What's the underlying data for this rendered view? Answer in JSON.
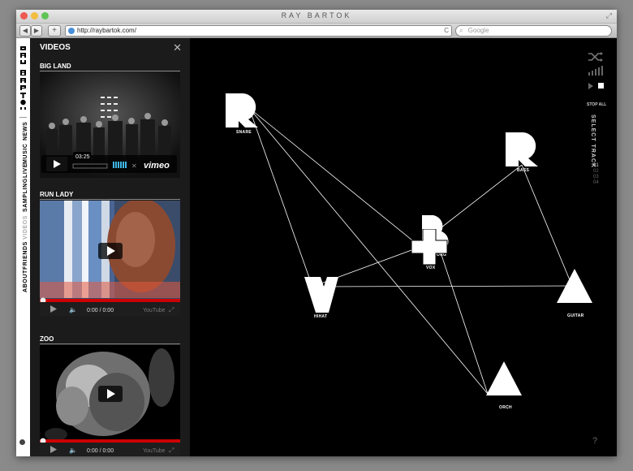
{
  "browser": {
    "window_title": "RAY BARTOK",
    "url": "http://raybartok.com/",
    "search_placeholder": "Google",
    "back_label": "◀",
    "forward_label": "▶",
    "add_label": "+",
    "reload_label": "C"
  },
  "nav": {
    "items": [
      "NEWS",
      "MUSIC",
      "LIVE",
      "SAMPLING",
      "VIDEOS",
      "FRIENDS",
      "ABOUT"
    ],
    "active": "VIDEOS",
    "logo_text": "RAY BARTOK"
  },
  "videos_panel": {
    "title": "VIDEOS",
    "videos": [
      {
        "title": "BIG LAND",
        "player": "vimeo",
        "time": "03:25",
        "brand": "vimeo"
      },
      {
        "title": "RUN LADY",
        "player": "youtube",
        "time": "0:00 / 0:00",
        "brand": "YouTube"
      },
      {
        "title": "ZOO",
        "player": "youtube",
        "time": "0:00 / 0:00",
        "brand": "YouTube"
      }
    ]
  },
  "stage": {
    "shapes": [
      {
        "label": "SNARE",
        "icon": "r-letter-icon"
      },
      {
        "label": "BASS",
        "icon": "r-letter-icon"
      },
      {
        "label": "VOX",
        "icon": "cross-icon"
      },
      {
        "label": "KORG",
        "icon": "b-letter-icon"
      },
      {
        "label": "HIHAT",
        "icon": "y-letter-icon"
      },
      {
        "label": "GUITAR",
        "icon": "triangle-icon"
      },
      {
        "label": "ORCH",
        "icon": "triangle-icon"
      }
    ],
    "controls": {
      "shuffle_icon": "shuffle-icon",
      "volume_icon": "volume-bars-icon",
      "stop_all": "STOP ALL"
    },
    "select_track": "SELECT TRACK",
    "tracks": [
      "01",
      "02",
      "03",
      "04"
    ],
    "active_track": "01",
    "help": "?"
  },
  "colors": {
    "stage_bg": "#000000",
    "panel_bg": "#1b1b1b",
    "progress_red": "#cc0000"
  }
}
